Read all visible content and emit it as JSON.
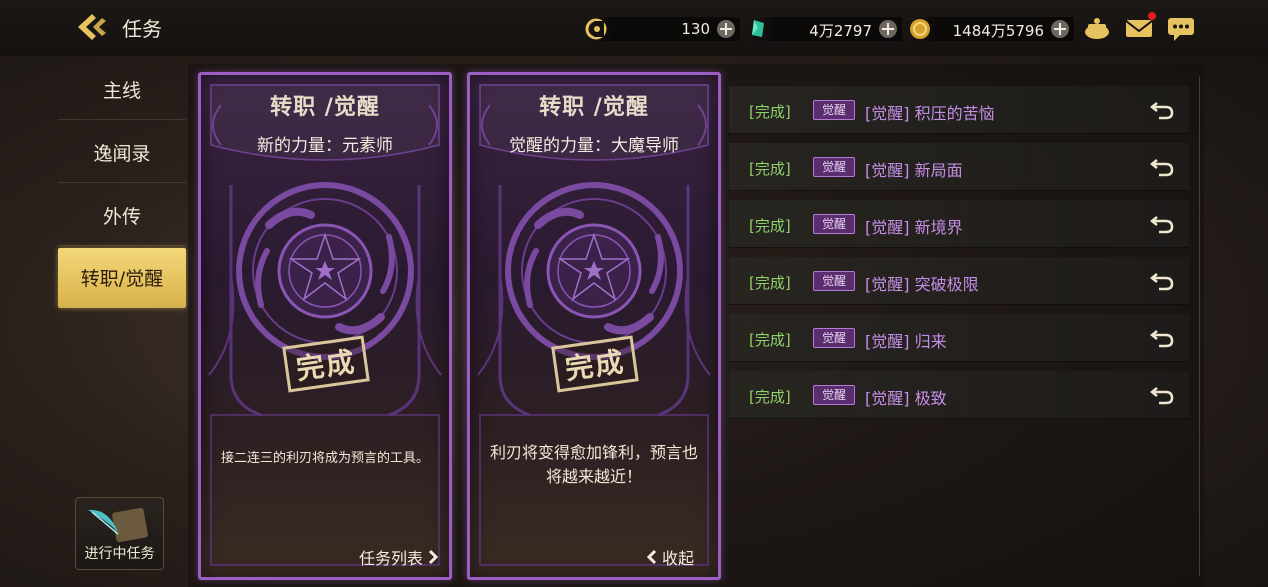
{
  "header": {
    "title": "任务",
    "currencies": [
      {
        "icon": "energy-icon",
        "value": "130"
      },
      {
        "icon": "green-gem-icon",
        "value": "4万2797"
      },
      {
        "icon": "gold-coin-icon",
        "value": "1484万5796"
      }
    ],
    "icons": [
      "pot-icon",
      "mail-icon",
      "chat-icon"
    ],
    "mail_badge": true
  },
  "sidebar": {
    "items": [
      {
        "label": "主线",
        "active": false
      },
      {
        "label": "逸闻录",
        "active": false
      },
      {
        "label": "外传",
        "active": false
      },
      {
        "label": "转职/觉醒",
        "active": true
      }
    ],
    "ongoing_label": "进行中任务"
  },
  "cards": [
    {
      "title": "转职 /觉醒",
      "subtitle": "新的力量：元素师",
      "stamp": "完成",
      "description": "接二连三的利刃将成为预言的工具。",
      "link": "任务列表",
      "link_icon": "chevron-right-icon"
    },
    {
      "title": "转职 /觉醒",
      "subtitle": "觉醒的力量：大魔导师",
      "stamp": "完成",
      "description": "利刃将变得愈加锋利，预言也将越来越近！",
      "link": "收起",
      "link_icon": "chevron-left-icon"
    }
  ],
  "quests": [
    {
      "status": "[完成]",
      "tag": "觉醒",
      "name": "[觉醒] 积压的苦恼"
    },
    {
      "status": "[完成]",
      "tag": "觉醒",
      "name": "[觉醒] 新局面"
    },
    {
      "status": "[完成]",
      "tag": "觉醒",
      "name": "[觉醒] 新境界"
    },
    {
      "status": "[完成]",
      "tag": "觉醒",
      "name": "[觉醒] 突破极限"
    },
    {
      "status": "[完成]",
      "tag": "觉醒",
      "name": "[觉醒] 归来"
    },
    {
      "status": "[完成]",
      "tag": "觉醒",
      "name": "[觉醒] 极致"
    }
  ],
  "colors": {
    "accent_gold": "#e6c260",
    "card_border": "#9b5fc4",
    "status_green": "#8fd16a",
    "quest_name": "#c58ee6"
  }
}
